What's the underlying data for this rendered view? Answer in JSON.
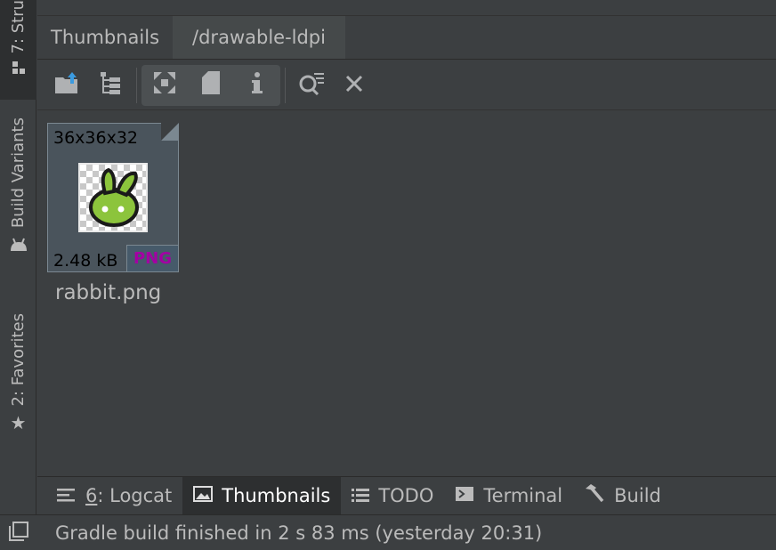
{
  "left_stripe": {
    "structure_label": "7: Stru",
    "build_variants_label": "Build Variants",
    "favorites_label": "2: Favorites"
  },
  "tabs": [
    {
      "label": "Thumbnails"
    },
    {
      "label": "/drawable-ldpi"
    }
  ],
  "toolbar": {
    "icons": [
      "export-icon",
      "tree-structure-icon",
      "zoom-fit-icon",
      "file-icon",
      "info-icon",
      "find-usages-icon",
      "close-icon"
    ]
  },
  "thumbnail": {
    "dimensions": "36x36x32",
    "file_size": "2.48 kB",
    "format": "PNG",
    "file_name": "rabbit.png"
  },
  "bottom_tabs": [
    {
      "number": "6",
      "label": ": Logcat",
      "icon": "logcat-icon"
    },
    {
      "label": "Thumbnails",
      "icon": "image-icon",
      "active": true
    },
    {
      "label": "TODO",
      "icon": "list-icon"
    },
    {
      "label": "Terminal",
      "icon": "terminal-icon"
    },
    {
      "label": "Build",
      "icon": "hammer-icon"
    }
  ],
  "status": {
    "text": "Gradle build finished in 2 s 83 ms (yesterday 20:31)"
  },
  "colors": {
    "background": "#3c3f41",
    "text": "#bbbbbb",
    "png_badge": "#a300a3"
  }
}
